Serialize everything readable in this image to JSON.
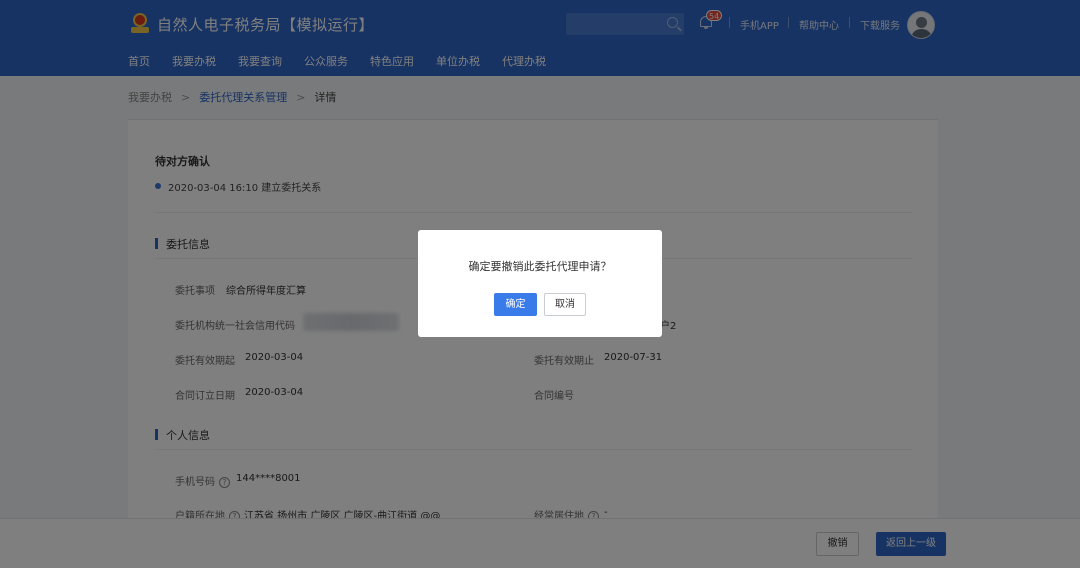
{
  "header": {
    "site_title": "自然人电子税务局【模拟运行】",
    "notification_count": "54",
    "links": [
      "手机APP",
      "帮助中心",
      "下载服务"
    ],
    "nav": [
      "首页",
      "我要办税",
      "我要查询",
      "公众服务",
      "特色应用",
      "单位办税",
      "代理办税"
    ]
  },
  "breadcrumb": {
    "items": [
      "我要办税",
      "委托代理关系管理",
      "详情"
    ]
  },
  "status": {
    "title": "待对方确认",
    "timeline": "2020-03-04 16:10 建立委托关系"
  },
  "entrust_section": {
    "title": "委托信息",
    "fields": [
      {
        "label": "委托事项",
        "value": "综合所得年度汇算"
      },
      {
        "label": "委托机构统一社会信用代码",
        "value": ""
      },
      {
        "label": "",
        "value": "户2"
      },
      {
        "label": "委托有效期起",
        "value": "2020-03-04"
      },
      {
        "label": "委托有效期止",
        "value": "2020-07-31"
      },
      {
        "label": "合同订立日期",
        "value": "2020-03-04"
      },
      {
        "label": "合同编号",
        "value": ""
      }
    ]
  },
  "personal_section": {
    "title": "个人信息",
    "fields": [
      {
        "label": "手机号码",
        "value": "144****8001"
      },
      {
        "label": "户籍所在地",
        "value": "江苏省 扬州市 广陵区 广陵区-曲江街道 @@"
      },
      {
        "label": "经常居住地",
        "value": "-"
      }
    ]
  },
  "footer": {
    "revoke_label": "撤销",
    "back_label": "返回上一级"
  },
  "dialog": {
    "message": "确定要撤销此委托代理申请？",
    "confirm_label": "确定",
    "cancel_label": "取消"
  },
  "colors": {
    "header_bg": "#2f66c7",
    "primary_button": "#3a7bea",
    "badge": "#e84a3b"
  }
}
